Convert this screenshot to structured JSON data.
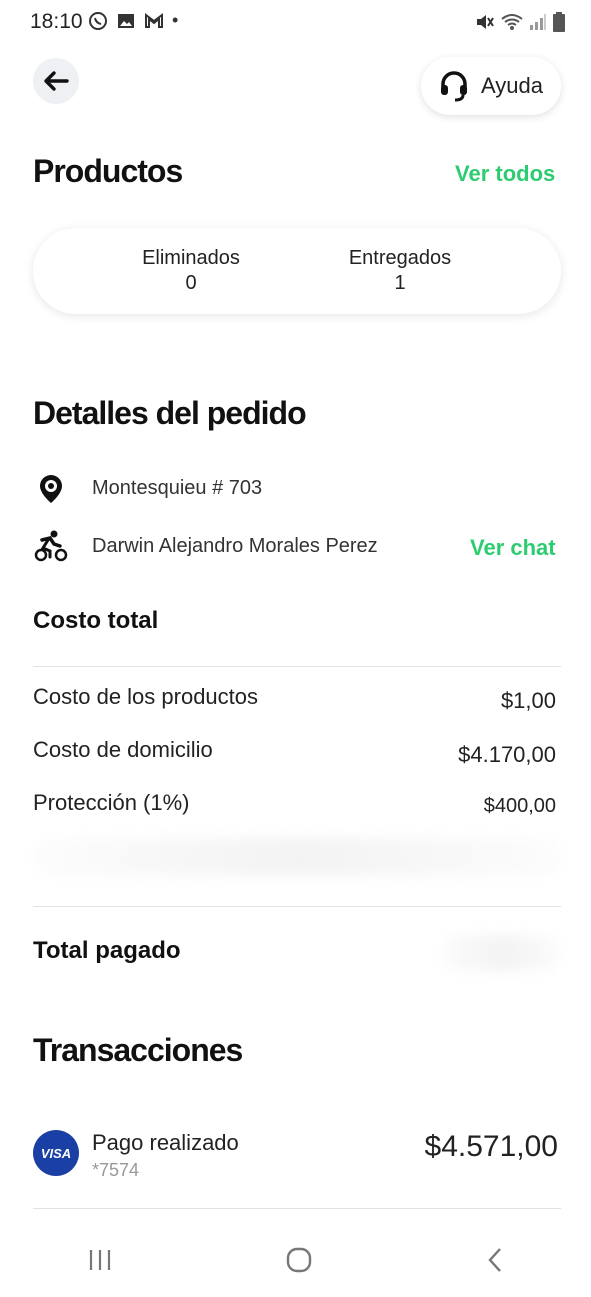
{
  "status_bar": {
    "time": "18:10",
    "dot": "•"
  },
  "header": {
    "help_label": "Ayuda"
  },
  "products": {
    "title": "Productos",
    "see_all": "Ver todos",
    "removed_label": "Eliminados",
    "removed_value": "0",
    "delivered_label": "Entregados",
    "delivered_value": "1"
  },
  "order_details": {
    "title": "Detalles del pedido",
    "address": "Montesquieu # 703",
    "courier": "Darwin Alejandro Morales Perez",
    "chat_link": "Ver chat"
  },
  "costs": {
    "title": "Costo total",
    "rows": [
      {
        "label": "Costo de los productos",
        "value": "$1,00"
      },
      {
        "label": "Costo de domicilio",
        "value": "$4.170,00"
      },
      {
        "label": "Protección (1%)",
        "value": "$400,00"
      }
    ],
    "total_label": "Total pagado"
  },
  "transactions": {
    "title": "Transacciones",
    "items": [
      {
        "brand": "VISA",
        "title": "Pago realizado",
        "card": "*7574",
        "amount": "$4.571,00"
      }
    ]
  },
  "icons": {
    "back": "arrow-left-icon",
    "help": "headset-icon",
    "address": "location-pin-icon",
    "courier": "cyclist-icon",
    "nav_recent": "recent-apps-icon",
    "nav_home": "home-icon",
    "nav_back": "back-chevron-icon"
  },
  "colors": {
    "accent": "#2ecc71",
    "visa": "#1a3fa5"
  }
}
